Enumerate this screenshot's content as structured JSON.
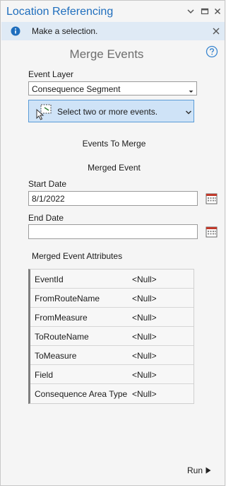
{
  "window": {
    "title": "Location Referencing"
  },
  "notice": {
    "text": "Make a selection."
  },
  "tool": {
    "title": "Merge Events"
  },
  "event_layer": {
    "label": "Event Layer",
    "value": "Consequence Segment"
  },
  "select_events": {
    "label": "Select two or more events."
  },
  "sections": {
    "events_to_merge": "Events To Merge",
    "merged_event": "Merged Event",
    "merged_event_attributes": "Merged Event Attributes"
  },
  "start_date": {
    "label": "Start Date",
    "value": "8/1/2022"
  },
  "end_date": {
    "label": "End Date",
    "value": ""
  },
  "attributes": [
    {
      "name": "EventId",
      "value": "<Null>"
    },
    {
      "name": "FromRouteName",
      "value": "<Null>"
    },
    {
      "name": "FromMeasure",
      "value": "<Null>"
    },
    {
      "name": "ToRouteName",
      "value": "<Null>"
    },
    {
      "name": "ToMeasure",
      "value": "<Null>"
    },
    {
      "name": "Field",
      "value": "<Null>"
    },
    {
      "name": "Consequence Area Type",
      "value": "<Null>"
    }
  ],
  "footer": {
    "run_label": "Run"
  },
  "colors": {
    "accent": "#1f6ebd",
    "notice_bg": "#dfeaf5",
    "selection_bg": "#cfe3f7"
  }
}
